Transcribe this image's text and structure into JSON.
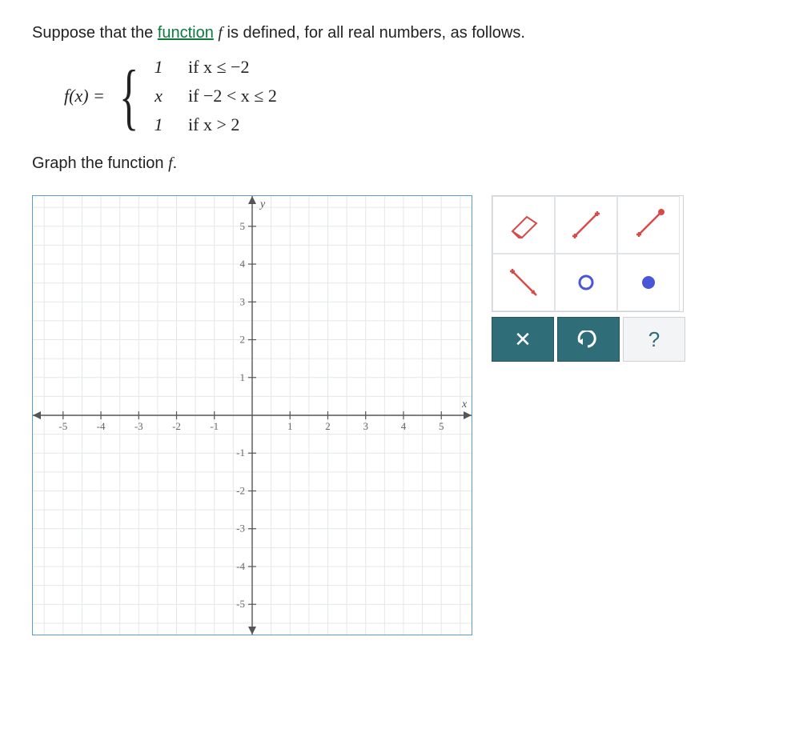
{
  "question": {
    "intro_pre": "Suppose that the ",
    "link_word": "function",
    "intro_mid": " ",
    "f_letter": "f",
    "intro_post": " is defined, for all real numbers, as follows."
  },
  "piecewise": {
    "lhs": "f(x) =",
    "rows": [
      {
        "value": "1",
        "condition": "if x ≤ −2"
      },
      {
        "value": "x",
        "condition": "if −2 < x ≤ 2"
      },
      {
        "value": "1",
        "condition": "if x > 2"
      }
    ]
  },
  "prompt2_pre": "Graph the function ",
  "prompt2_f": "f",
  "prompt2_post": ".",
  "chart_data": {
    "type": "scatter",
    "title": "",
    "xlabel": "x",
    "ylabel": "y",
    "xlim": [
      -5.8,
      5.8
    ],
    "ylim": [
      -5.8,
      5.8
    ],
    "x_ticks": [
      -5,
      -4,
      -3,
      -2,
      -1,
      1,
      2,
      3,
      4,
      5
    ],
    "y_ticks": [
      -5,
      -4,
      -3,
      -2,
      -1,
      1,
      2,
      3,
      4,
      5
    ],
    "gridlines": true,
    "series": []
  },
  "tools": {
    "eraser": "eraser-tool",
    "segment_closed": "segment-closed-endpoints-tool",
    "segment_open": "segment-open-closed-tool",
    "ray": "ray-tool",
    "open_point": "open-point-tool",
    "closed_point": "closed-point-tool"
  },
  "actions": {
    "clear": "✕",
    "undo": "↶",
    "help": "?"
  }
}
